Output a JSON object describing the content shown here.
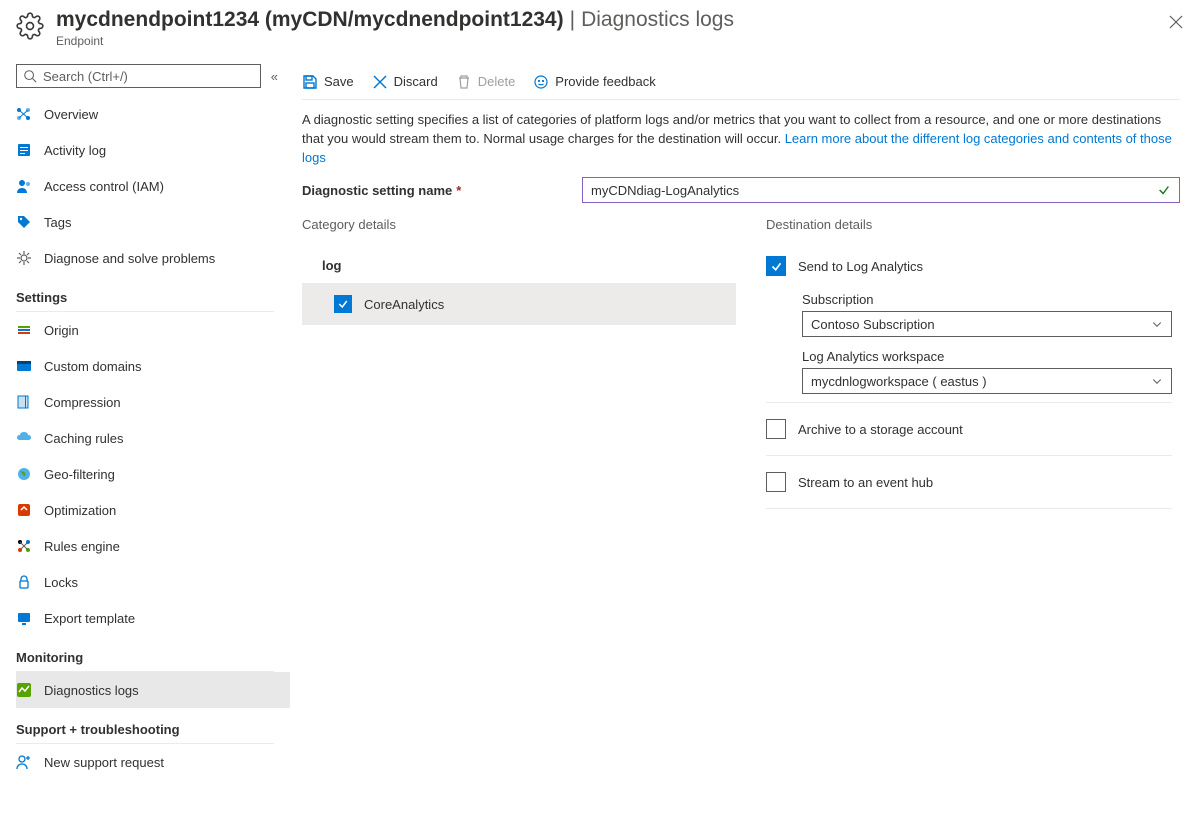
{
  "header": {
    "title": "mycdnendpoint1234 (myCDN/mycdnendpoint1234)",
    "separator": " | ",
    "page": "Diagnostics logs",
    "subtitle": "Endpoint"
  },
  "sidebar": {
    "search_placeholder": "Search (Ctrl+/)",
    "top": [
      {
        "label": "Overview",
        "icon": "overview-icon"
      },
      {
        "label": "Activity log",
        "icon": "activity-icon"
      },
      {
        "label": "Access control (IAM)",
        "icon": "access-icon"
      },
      {
        "label": "Tags",
        "icon": "tag-icon"
      },
      {
        "label": "Diagnose and solve problems",
        "icon": "diagnose-icon"
      }
    ],
    "settings_title": "Settings",
    "settings": [
      {
        "label": "Origin",
        "icon": "origin-icon"
      },
      {
        "label": "Custom domains",
        "icon": "domain-icon"
      },
      {
        "label": "Compression",
        "icon": "compress-icon"
      },
      {
        "label": "Caching rules",
        "icon": "cache-icon"
      },
      {
        "label": "Geo-filtering",
        "icon": "geo-icon"
      },
      {
        "label": "Optimization",
        "icon": "opt-icon"
      },
      {
        "label": "Rules engine",
        "icon": "rules-icon"
      },
      {
        "label": "Locks",
        "icon": "lock-icon"
      },
      {
        "label": "Export template",
        "icon": "export-icon"
      }
    ],
    "monitoring_title": "Monitoring",
    "monitoring": [
      {
        "label": "Diagnostics logs",
        "icon": "diag-icon",
        "active": true
      }
    ],
    "support_title": "Support + troubleshooting",
    "support": [
      {
        "label": "New support request",
        "icon": "support-icon"
      }
    ]
  },
  "toolbar": {
    "save": "Save",
    "discard": "Discard",
    "delete": "Delete",
    "feedback": "Provide feedback"
  },
  "main": {
    "desc_a": "A diagnostic setting specifies a list of categories of platform logs and/or metrics that you want to collect from a resource, and one or more destinations that you would stream them to. Normal usage charges for the destination will occur. ",
    "desc_link": "Learn more about the different log categories and contents of those logs",
    "name_label": "Diagnostic setting name",
    "name_value": "myCDNdiag-LogAnalytics",
    "category_title": "Category details",
    "log_label": "log",
    "log_item": "CoreAnalytics",
    "dest_title": "Destination details",
    "dest_la": "Send to Log Analytics",
    "sub_label": "Subscription",
    "sub_value": "Contoso Subscription",
    "ws_label": "Log Analytics workspace",
    "ws_value": "mycdnlogworkspace ( eastus )",
    "dest_storage": "Archive to a storage account",
    "dest_hub": "Stream to an event hub"
  }
}
